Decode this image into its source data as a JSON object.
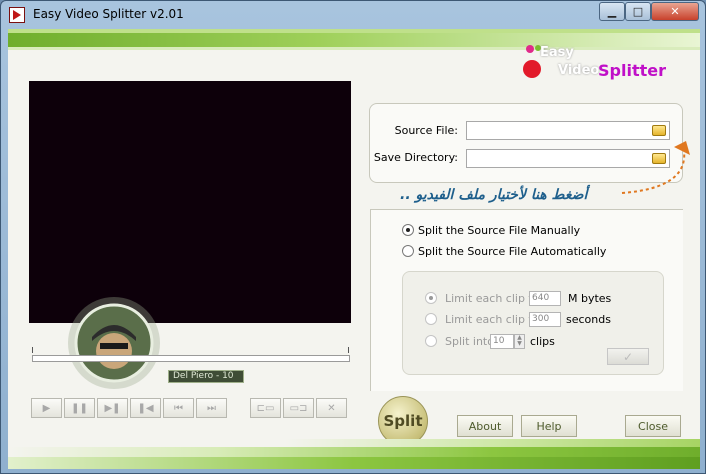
{
  "window": {
    "title": "Easy Video Splitter v2.01",
    "minimize_glyph": "▁",
    "maximize_glyph": "□",
    "close_glyph": "✕"
  },
  "logo": {
    "line1": "Easy",
    "line2a": "Video",
    "line2b": "Splitter"
  },
  "avatar": {
    "caption": "Del Piero - 10"
  },
  "player_controls": [
    {
      "name": "play-button",
      "icon": "play-icon",
      "glyph": "▶"
    },
    {
      "name": "pause-button",
      "icon": "pause-icon",
      "glyph": "❚❚"
    },
    {
      "name": "step-forward-button",
      "icon": "step-forward-icon",
      "glyph": "▶❚"
    },
    {
      "name": "step-back-button",
      "icon": "step-back-icon",
      "glyph": "❚◀"
    },
    {
      "name": "skip-start-button",
      "icon": "skip-start-icon",
      "glyph": "⏮"
    },
    {
      "name": "skip-end-button",
      "icon": "skip-end-icon",
      "glyph": "⏭"
    }
  ],
  "marker_controls": [
    {
      "name": "set-start-marker-button",
      "icon": "film-start-icon",
      "glyph": "⊏▭"
    },
    {
      "name": "set-end-marker-button",
      "icon": "film-end-icon",
      "glyph": "▭⊐"
    },
    {
      "name": "clear-markers-button",
      "icon": "close-icon",
      "glyph": "✕"
    }
  ],
  "file_panel": {
    "source_label": "Source File:",
    "source_value": "",
    "save_label": "Save Directory:",
    "save_value": ""
  },
  "hint_arabic": "أضغط هنا لأختيار ملف الفيديو ..",
  "options": {
    "manual_label": "Split the Source File Manually",
    "auto_label": "Split the Source File Automatically",
    "selected": "manual",
    "limit_size_label": "Limit each clip to",
    "limit_size_value": "640",
    "limit_size_unit": "M bytes",
    "limit_time_label": "Limit each clip to",
    "limit_time_value": "300",
    "limit_time_unit": "seconds",
    "split_into_label": "Split into",
    "split_into_value": "10",
    "split_into_unit": "clips",
    "apply_glyph": "✓"
  },
  "buttons": {
    "split": "Split",
    "about": "About",
    "help": "Help",
    "close": "Close"
  },
  "colors": {
    "accent_green": "#8cc640",
    "hint_blue": "#1e5f8c",
    "arrow_orange": "#e07820",
    "video_bg": "#0d000a"
  }
}
